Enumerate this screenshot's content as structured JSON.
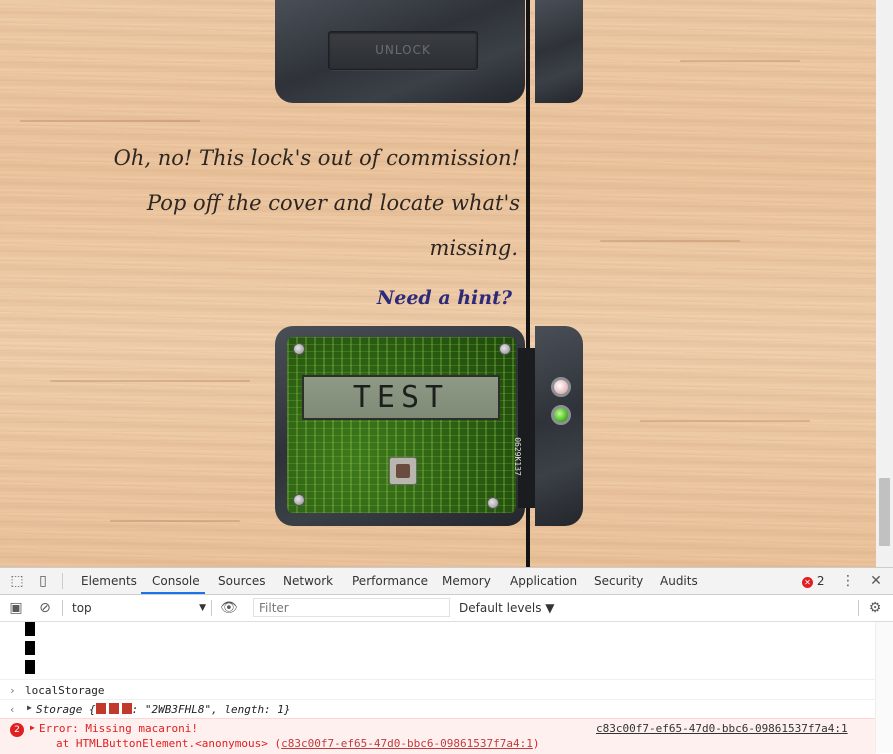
{
  "page": {
    "unlock_label": "UNLOCK",
    "story_line1": "Oh, no! This lock's out of commission!",
    "story_line2": "Pop off the cover and locate what's",
    "story_line3": "missing.",
    "hint_link": "Need a hint?",
    "lcd_text": "TEST",
    "serial_text": "0629K137"
  },
  "devtools": {
    "tabs": [
      "Elements",
      "Console",
      "Sources",
      "Network",
      "Performance",
      "Memory",
      "Application",
      "Security",
      "Audits"
    ],
    "active_tab": "Console",
    "error_count": "2",
    "context": "top",
    "filter_placeholder": "Filter",
    "levels_label": "Default levels ▼"
  },
  "console": {
    "input_cmd": "localStorage",
    "storage_prefix": "Storage {",
    "storage_key_placeholder": "",
    "storage_value": ": \"2WB3FHL8\", length: 1}",
    "error_badge": "2",
    "error_message": "Error: Missing macaroni!",
    "error_stack": "at HTMLButtonElement.<anonymous> (",
    "error_stack_link": "c83c00f7-ef65-47d0-bbc6-09861537f7a4:1",
    "error_stack_close": ")",
    "error_source_link": "c83c00f7-ef65-47d0-bbc6-09861537f7a4:1"
  },
  "colors": {
    "accent": "#1a73e8",
    "error": "#e02020",
    "hint": "#2e2a7a",
    "led_green": "#56c22a"
  }
}
